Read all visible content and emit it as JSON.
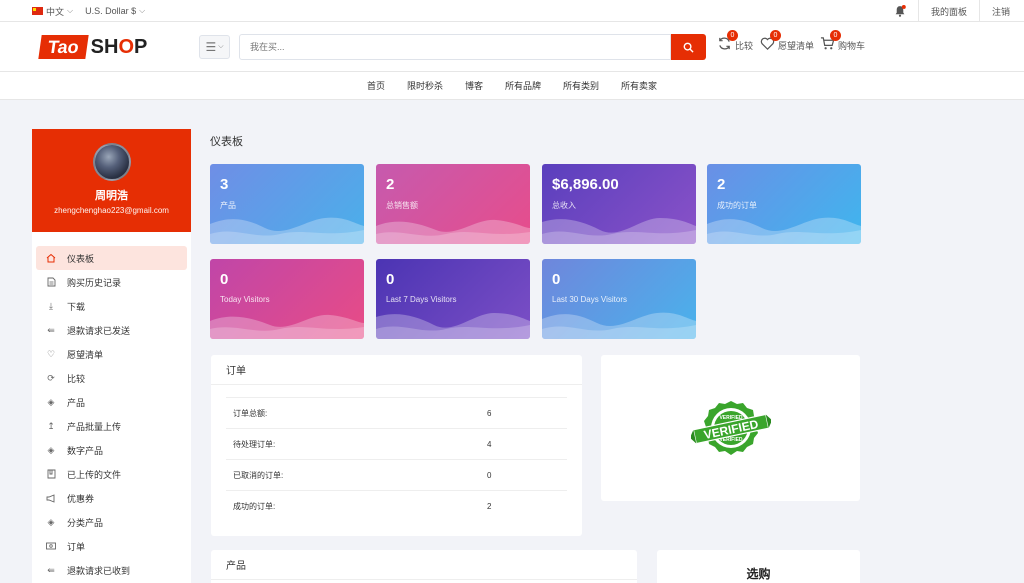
{
  "topbar": {
    "language": "中文",
    "currency": "U.S. Dollar $",
    "my_dashboard": "我的面板",
    "logout": "注销"
  },
  "header": {
    "logo_part1": "Tao",
    "logo_part2a": "SH",
    "logo_part2b": "O",
    "logo_part2c": "P",
    "search_placeholder": "我在买...",
    "compare": {
      "label": "比较",
      "count": "0"
    },
    "wishlist": {
      "label": "愿望清单",
      "count": "0"
    },
    "cart": {
      "label": "购物车",
      "count": "0"
    }
  },
  "nav": [
    "首页",
    "限时秒杀",
    "博客",
    "所有品牌",
    "所有类别",
    "所有卖家"
  ],
  "profile": {
    "name": "周明浩",
    "email": "zhengchenghao223@gmail.com"
  },
  "sidebar": {
    "items": [
      {
        "label": "仪表板",
        "icon": "home-icon",
        "active": true
      },
      {
        "label": "购买历史记录",
        "icon": "file-icon"
      },
      {
        "label": "下载",
        "icon": "download-icon"
      },
      {
        "label": "退款请求已发送",
        "icon": "reply-icon"
      },
      {
        "label": "愿望清单",
        "icon": "heart-icon"
      },
      {
        "label": "比较",
        "icon": "refresh-icon"
      },
      {
        "label": "产品",
        "icon": "diamond-icon"
      },
      {
        "label": "产品批量上传",
        "icon": "upload-icon"
      },
      {
        "label": "数字产品",
        "icon": "diamond-icon"
      },
      {
        "label": "已上传的文件",
        "icon": "folder-icon"
      },
      {
        "label": "优惠券",
        "icon": "megaphone-icon"
      },
      {
        "label": "分类产品",
        "icon": "diamond-icon"
      },
      {
        "label": "订单",
        "icon": "money-icon"
      },
      {
        "label": "退款请求已收到",
        "icon": "reply-icon"
      }
    ]
  },
  "main": {
    "title": "仪表板",
    "cards": [
      {
        "value": "3",
        "label": "产品"
      },
      {
        "value": "2",
        "label": "总销售额"
      },
      {
        "value": "$6,896.00",
        "label": "总收入"
      },
      {
        "value": "2",
        "label": "成功的订单"
      },
      {
        "value": "0",
        "label": "Today Visitors"
      },
      {
        "value": "0",
        "label": "Last 7 Days Visitors"
      },
      {
        "value": "0",
        "label": "Last 30 Days Visitors"
      }
    ],
    "orders": {
      "title": "订单",
      "rows": [
        {
          "label": "订单总额:",
          "value": "6"
        },
        {
          "label": "待处理订单:",
          "value": "4"
        },
        {
          "label": "已取消的订单:",
          "value": "0"
        },
        {
          "label": "成功的订单:",
          "value": "2"
        }
      ]
    },
    "verified_badge": {
      "top": "VERIFIED",
      "middle": "VERIFIED",
      "bottom": "VERIFIED"
    },
    "products_panel_title": "产品",
    "purchase_panel_title": "选购"
  },
  "colors": {
    "accent": "#e62e04",
    "active_bg": "#fde4de",
    "badge_green": "#3aa52c"
  }
}
